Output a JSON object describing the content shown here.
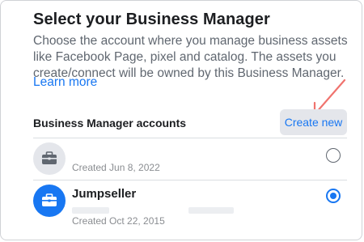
{
  "dialog": {
    "title": "Select your Business Manager",
    "description": "Choose the account where you manage business assets like Facebook Page, pixel and catalog. The assets you create/connect will be owned by this Business Manager.",
    "learn_more": "Learn more"
  },
  "accounts_section": {
    "label": "Business Manager accounts",
    "create_new": "Create new"
  },
  "accounts": [
    {
      "name": "",
      "created": "Created Jun 8, 2022",
      "selected": false,
      "icon": "briefcase-icon"
    },
    {
      "name": "Jumpseller",
      "created": "Created Oct 22, 2015",
      "selected": true,
      "icon": "briefcase-icon"
    }
  ],
  "colors": {
    "accent": "#1877f2",
    "annotation_arrow": "#f0736e"
  }
}
